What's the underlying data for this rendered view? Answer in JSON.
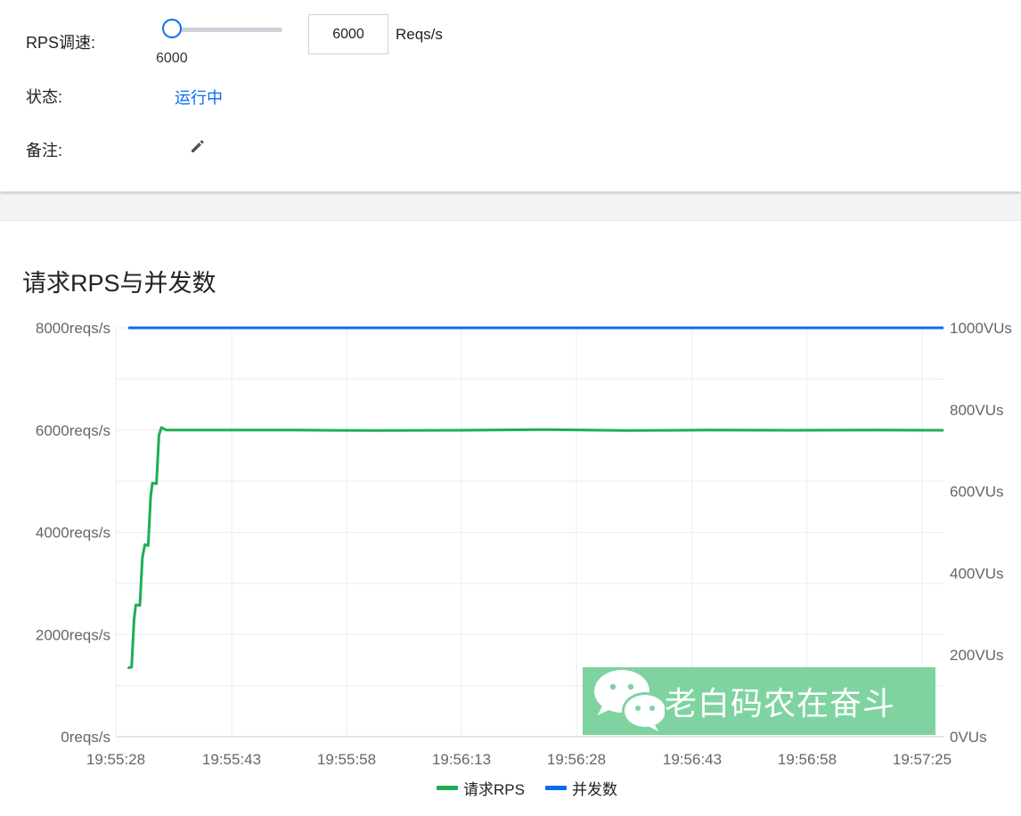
{
  "settings": {
    "rps_label": "RPS调速:",
    "slider_value": "6000",
    "slider_fraction": 0.0,
    "input_value": "6000",
    "unit": "Reqs/s",
    "status_label": "状态:",
    "status_value": "运行中",
    "note_label": "备注:"
  },
  "chart": {
    "title": "请求RPS与并发数"
  },
  "watermark": {
    "text": "老白码农在奋斗"
  },
  "colors": {
    "rps": "#1fae56",
    "vus": "#0b6cf0",
    "accent": "#0b6cf0",
    "watermark_bg": "#7fd3a0"
  },
  "chart_data": {
    "type": "line",
    "title": "请求RPS与并发数",
    "x_tick_labels": [
      "19:55:28",
      "19:55:43",
      "19:55:58",
      "19:56:13",
      "19:56:28",
      "19:56:43",
      "19:56:58",
      "19:57:25"
    ],
    "y_left": {
      "ticks": [
        0,
        2000,
        4000,
        6000,
        8000
      ],
      "tick_labels": [
        "0reqs/s",
        "2000reqs/s",
        "4000reqs/s",
        "6000reqs/s",
        "8000reqs/s"
      ],
      "range": [
        0,
        8000
      ]
    },
    "y_right": {
      "ticks": [
        0,
        200,
        400,
        600,
        800,
        1000
      ],
      "tick_labels": [
        "0VUs",
        "200VUs",
        "400VUs",
        "600VUs",
        "800VUs",
        "1000VUs"
      ],
      "range": [
        0,
        1000
      ]
    },
    "grid": true,
    "legend_position": "bottom-center",
    "series": [
      {
        "name": "请求RPS",
        "axis": "left",
        "color": "#1fae56",
        "points": [
          [
            0.0,
            1360
          ],
          [
            0.01,
            1350
          ],
          [
            0.2,
            1360
          ],
          [
            0.35,
            2300
          ],
          [
            0.45,
            2580
          ],
          [
            0.7,
            2570
          ],
          [
            0.85,
            3500
          ],
          [
            1.0,
            3760
          ],
          [
            1.2,
            3740
          ],
          [
            1.35,
            4700
          ],
          [
            1.45,
            4960
          ],
          [
            1.7,
            4950
          ],
          [
            1.85,
            5900
          ],
          [
            2.0,
            6050
          ],
          [
            2.3,
            6000
          ],
          [
            5,
            6000
          ],
          [
            10,
            6000
          ],
          [
            15,
            5990
          ],
          [
            20,
            5995
          ],
          [
            25,
            6010
          ],
          [
            30,
            5990
          ],
          [
            35,
            6000
          ],
          [
            40,
            5995
          ],
          [
            45,
            6000
          ],
          [
            49.2,
            5995
          ]
        ]
      },
      {
        "name": "并发数",
        "axis": "right",
        "color": "#0b6cf0",
        "points": [
          [
            0.0,
            1000
          ],
          [
            49.2,
            1000
          ]
        ]
      }
    ]
  }
}
